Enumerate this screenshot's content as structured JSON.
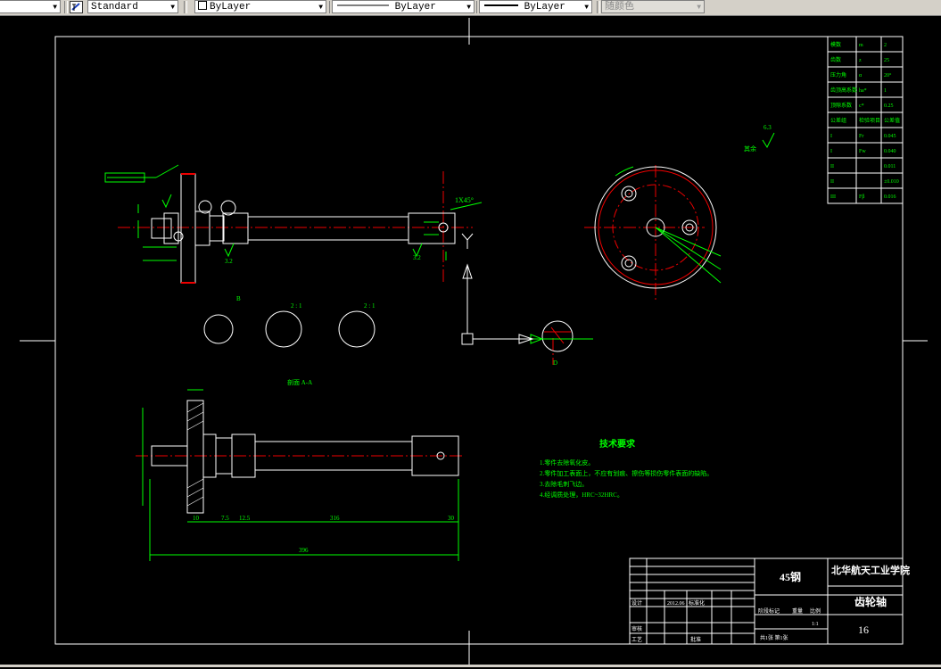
{
  "toolbar": {
    "textstyle_value": "Standard",
    "layer_value": "ByLayer",
    "linetype_value": "ByLayer",
    "lineweight_value": "ByLayer",
    "plotstyle_value": "随颜色"
  },
  "drawing": {
    "ucs_y_label": "Y",
    "title_block": {
      "material": "45钢",
      "school": "北华航天工业学院",
      "part_name": "齿轮轴",
      "drawing_no": "16",
      "scale_label": "比例",
      "scale_value": "1:1",
      "stage_label": "阶段标记",
      "weight_label": "重量",
      "sheet_info": "共1张 第1张",
      "design_label": "设计",
      "design_date": "2012.06",
      "process_label": "工艺",
      "review_label": "审核",
      "approve_label": "批准",
      "std_label": "标准化"
    },
    "tech_req": {
      "title": "技术要求",
      "lines": [
        "1.零件去除氧化皮。",
        "2.零件加工表面上，不应有划痕、擦伤等损伤零件表面的缺陷。",
        "3.去除毛刺飞边。",
        "4.经调质处理，HRC~32HRC。"
      ]
    },
    "param_table": {
      "rows": [
        [
          "模数",
          "m",
          "2"
        ],
        [
          "齿数",
          "z",
          "25"
        ],
        [
          "压力角",
          "α",
          "20°"
        ],
        [
          "齿顶高系数",
          "ha*",
          "1"
        ],
        [
          "顶隙系数",
          "c*",
          "0.25"
        ],
        [
          "公差组",
          "检验项目",
          "公差值"
        ],
        [
          "I",
          "Fr",
          "0.045"
        ],
        [
          "I",
          "Fw",
          "0.040"
        ],
        [
          "II",
          "",
          "0.011"
        ],
        [
          "II",
          "",
          "±0.010"
        ],
        [
          "III",
          "Fβ",
          "0.016"
        ]
      ]
    },
    "dims": {
      "total_length": "396",
      "len_a": "10",
      "len_b": "7.5",
      "len_c": "12.5",
      "len_d": "316",
      "len_e": "30",
      "chamfer": "1X45°",
      "view_section": "剖面 A-A",
      "detail_b": "B",
      "detail_scale": "2 : 1",
      "detail_d": "D",
      "ra_1": "3.2",
      "ra_2": "3.2",
      "ra_3": "6.3",
      "other_ra": "其余"
    }
  }
}
